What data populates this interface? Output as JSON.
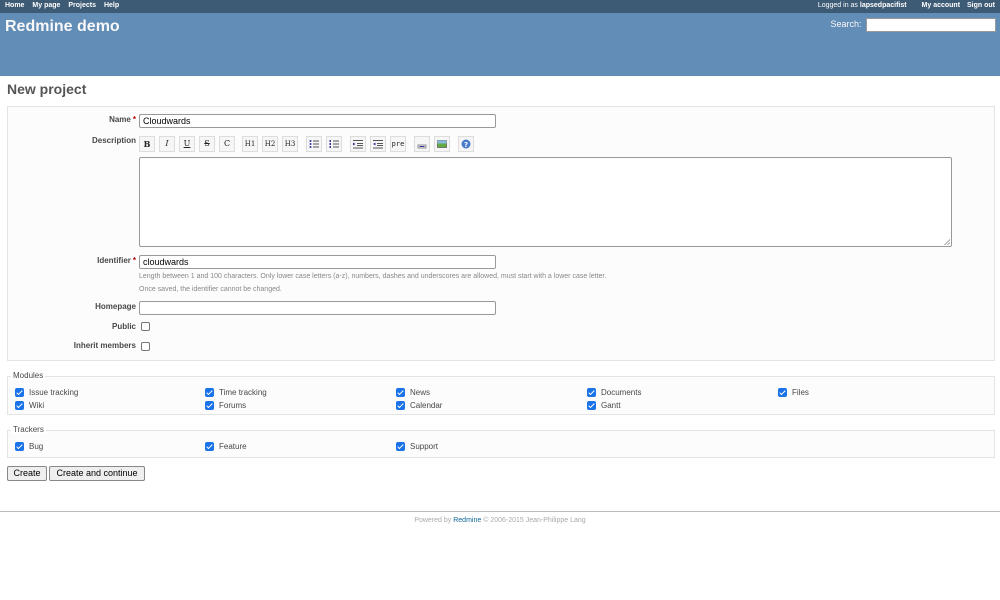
{
  "top_menu": {
    "items": [
      "Home",
      "My page",
      "Projects",
      "Help"
    ],
    "logged_in_prefix": "Logged in as",
    "username": "lapsedpacifist",
    "my_account": "My account",
    "sign_out": "Sign out"
  },
  "header": {
    "title": "Redmine demo",
    "search_label": "Search:"
  },
  "page": {
    "title": "New project"
  },
  "form": {
    "name_label": "Name",
    "name_value": "Cloudwards",
    "description_label": "Description",
    "toolbar": [
      {
        "label": "B",
        "name": "bold-button"
      },
      {
        "label": "I",
        "name": "italic-button"
      },
      {
        "label": "U",
        "name": "underline-button"
      },
      {
        "label": "S",
        "name": "strikethrough-button"
      },
      {
        "label": "C",
        "name": "code-button"
      },
      {
        "label": "H1",
        "name": "heading1-button"
      },
      {
        "label": "H2",
        "name": "heading2-button"
      },
      {
        "label": "H3",
        "name": "heading3-button"
      },
      {
        "label": "ul",
        "name": "unordered-list-button"
      },
      {
        "label": "ol",
        "name": "ordered-list-button"
      },
      {
        "label": "indent",
        "name": "indent-button"
      },
      {
        "label": "outdent",
        "name": "outdent-button"
      },
      {
        "label": "pre",
        "name": "preformatted-button"
      },
      {
        "label": "link",
        "name": "wiki-link-button"
      },
      {
        "label": "img",
        "name": "image-button"
      },
      {
        "label": "help",
        "name": "help-button"
      }
    ],
    "required_mark": "*",
    "identifier_label": "Identifier",
    "identifier_value": "cloudwards",
    "identifier_hint1": "Length between 1 and 100 characters. Only lower case letters (a-z), numbers, dashes and underscores are allowed, must start with a lower case letter.",
    "identifier_hint2": "Once saved, the identifier cannot be changed.",
    "homepage_label": "Homepage",
    "homepage_value": "",
    "public_label": "Public",
    "public_checked": false,
    "inherit_label": "Inherit members",
    "inherit_checked": false
  },
  "modules": {
    "legend": "Modules",
    "items": [
      {
        "label": "Issue tracking",
        "checked": true
      },
      {
        "label": "Time tracking",
        "checked": true
      },
      {
        "label": "News",
        "checked": true
      },
      {
        "label": "Documents",
        "checked": true
      },
      {
        "label": "Files",
        "checked": true
      },
      {
        "label": "Wiki",
        "checked": true
      },
      {
        "label": "Forums",
        "checked": true
      },
      {
        "label": "Calendar",
        "checked": true
      },
      {
        "label": "Gantt",
        "checked": true
      }
    ]
  },
  "trackers": {
    "legend": "Trackers",
    "items": [
      {
        "label": "Bug",
        "checked": true
      },
      {
        "label": "Feature",
        "checked": true
      },
      {
        "label": "Support",
        "checked": true
      }
    ]
  },
  "buttons": {
    "create": "Create",
    "create_continue": "Create and continue"
  },
  "footer": {
    "powered_by": "Powered by",
    "link": "Redmine",
    "copyright": "© 2006-2015 Jean-Philippe Lang"
  }
}
